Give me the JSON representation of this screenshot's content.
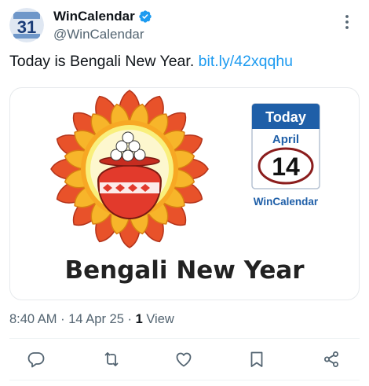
{
  "tweet": {
    "display_name": "WinCalendar",
    "handle": "@WinCalendar",
    "avatar_text": "31",
    "text": "Today is Bengali New Year.",
    "link": "bit.ly/42xqqhu",
    "time": "8:40 AM",
    "date": "14 Apr 25",
    "views_count": "1",
    "views_label": "View"
  },
  "media": {
    "title": "Bengali New Year",
    "calendar_header": "Today",
    "calendar_month": "April",
    "calendar_day": "14",
    "calendar_brand": "WinCalendar"
  },
  "icons": {
    "verified": "verified-badge-icon",
    "more": "more-icon",
    "reply": "reply-icon",
    "retweet": "retweet-icon",
    "like": "like-icon",
    "bookmark": "bookmark-icon",
    "share": "share-icon"
  },
  "colors": {
    "link": "#1d9bf0",
    "verified": "#1d9bf0",
    "secondary_text": "#536471",
    "calendar_blue": "#1f5fa8",
    "circle_red": "#8b1d1d"
  }
}
